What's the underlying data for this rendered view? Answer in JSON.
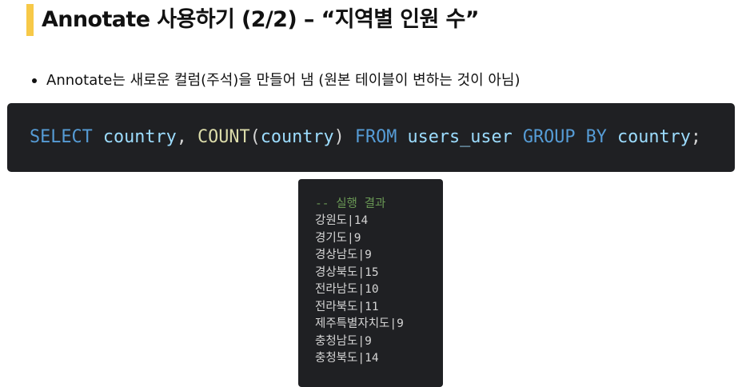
{
  "slide": {
    "title": "Annotate 사용하기 (2/2) – “지역별 인원 수”",
    "bullet": "Annotate는 새로운 컬럼(주석)을 만들어 냄 (원본 테이블이 변하는 것이 아님)"
  },
  "code": {
    "tokens": [
      {
        "text": "SELECT",
        "role": "kw"
      },
      {
        "text": " ",
        "role": "punct"
      },
      {
        "text": "country",
        "role": "ident"
      },
      {
        "text": ", ",
        "role": "punct"
      },
      {
        "text": "COUNT",
        "role": "func"
      },
      {
        "text": "(",
        "role": "punct"
      },
      {
        "text": "country",
        "role": "ident"
      },
      {
        "text": ")",
        "role": "punct"
      },
      {
        "text": " ",
        "role": "punct"
      },
      {
        "text": "FROM",
        "role": "kw"
      },
      {
        "text": " ",
        "role": "punct"
      },
      {
        "text": "users_user",
        "role": "ident"
      },
      {
        "text": " ",
        "role": "punct"
      },
      {
        "text": "GROUP",
        "role": "kw"
      },
      {
        "text": " ",
        "role": "punct"
      },
      {
        "text": "BY",
        "role": "kw"
      },
      {
        "text": " ",
        "role": "punct"
      },
      {
        "text": "country",
        "role": "ident"
      },
      {
        "text": ";",
        "role": "punct"
      }
    ]
  },
  "result": {
    "comment": "-- 실행 결과",
    "rows": [
      "강원도|14",
      "경기도|9",
      "경상남도|9",
      "경상북도|15",
      "전라남도|10",
      "전라북도|11",
      "제주특별자치도|9",
      "충청남도|9",
      "충청북도|14"
    ]
  },
  "colors": {
    "accent_bar": "#f7c948",
    "code_bg": "#1f2023",
    "keyword": "#569cd6",
    "identifier": "#9cdcfe",
    "function": "#dcdcaa",
    "comment": "#6a9955",
    "plain": "#d4d4d4"
  }
}
